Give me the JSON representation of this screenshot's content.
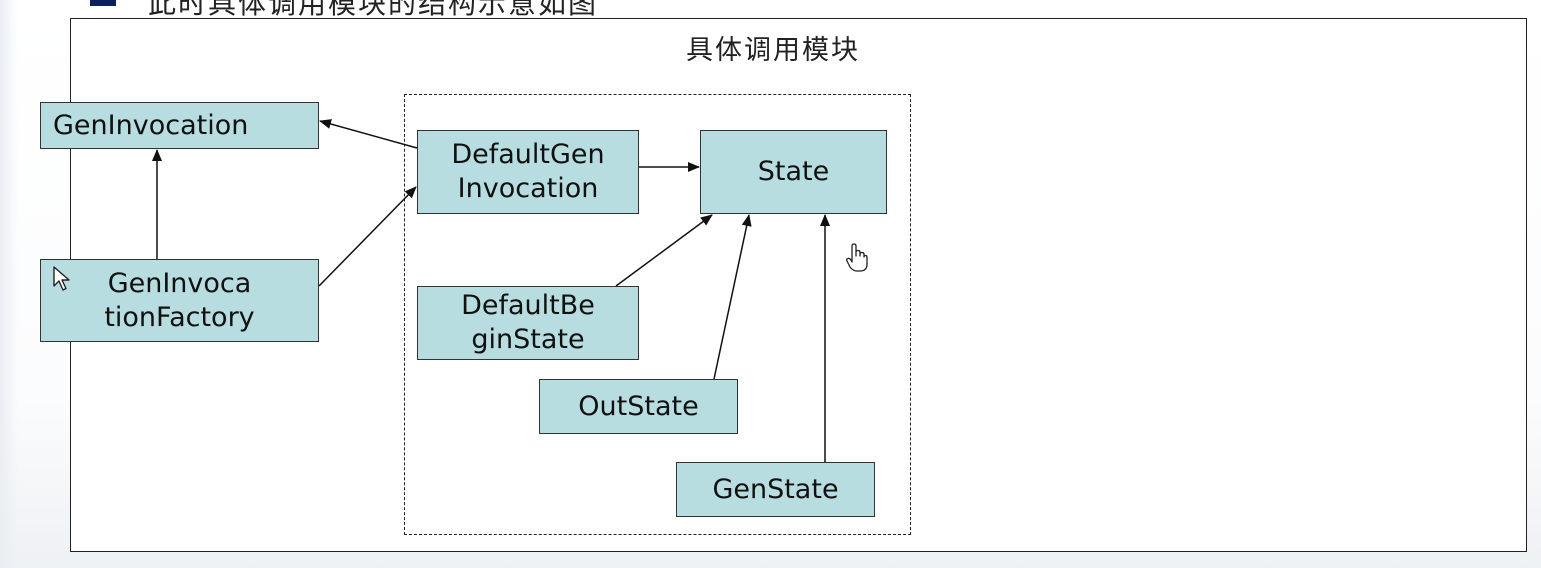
{
  "slide": {
    "heading": "此时具体调用模块的结构示意如图"
  },
  "diagram": {
    "module_title": "具体调用模块",
    "nodes": {
      "gen_invocation": [
        "GenInvocation"
      ],
      "gen_invocation_factory": [
        "GenInvoca",
        "tionFactory"
      ],
      "default_gen_invocation": [
        "DefaultGen",
        "Invocation"
      ],
      "state": [
        "State"
      ],
      "default_begin_state": [
        "DefaultBe",
        "ginState"
      ],
      "out_state": [
        "OutState"
      ],
      "gen_state": [
        "GenState"
      ]
    },
    "edges": [
      {
        "from": "default_gen_invocation",
        "to": "gen_invocation"
      },
      {
        "from": "gen_invocation_factory",
        "to": "gen_invocation"
      },
      {
        "from": "gen_invocation_factory",
        "to": "default_gen_invocation"
      },
      {
        "from": "default_gen_invocation",
        "to": "state"
      },
      {
        "from": "default_begin_state",
        "to": "state"
      },
      {
        "from": "out_state",
        "to": "state"
      },
      {
        "from": "gen_state",
        "to": "state"
      }
    ]
  },
  "colors": {
    "node_fill": "#b7dde1",
    "line": "#111111",
    "heading_bullet": "#0a1f5c"
  },
  "icons": [
    "arrow-pointer-icon",
    "hand-pointer-icon"
  ]
}
